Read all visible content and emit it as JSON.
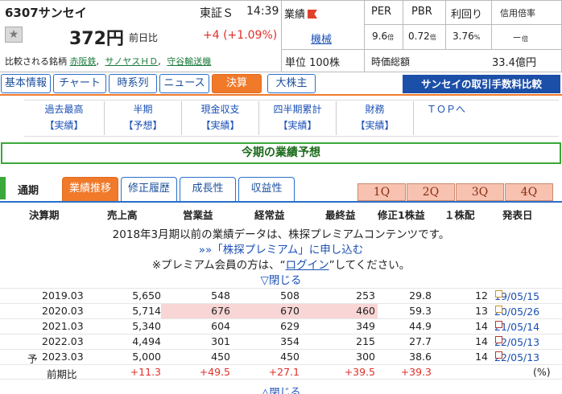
{
  "header": {
    "code_name": "6307サンセイ",
    "market": "東証Ｓ",
    "time": "14:39",
    "gyoseki_label": "業績",
    "price": "372円",
    "prev_label": "前日比",
    "change": "+4",
    "change_pct": "(+1.09%)",
    "sector": "機械",
    "compare_label": "比較される銘柄",
    "peers": [
      "赤阪鉄",
      "サノヤスＨＤ",
      "守谷輸送機"
    ],
    "unit": "単位 100株",
    "per_label": "PER",
    "pbr_label": "PBR",
    "yield_label": "利回り",
    "margin_label": "信用倍率",
    "per": "9.6",
    "per_unit": "倍",
    "pbr": "0.72",
    "pbr_unit": "倍",
    "yield": "3.76",
    "yield_unit": "%",
    "margin": "－",
    "margin_unit": "倍",
    "mcap_label": "時価総額",
    "mcap": "33.4億円"
  },
  "tabs": [
    "基本情報",
    "チャート",
    "時系列",
    "ニュース",
    "決算",
    "大株主"
  ],
  "fee_button": "サンセイの取引手数料比較",
  "subnav": [
    {
      "l1": "過去最高",
      "l2": "【実績】"
    },
    {
      "l1": "半期",
      "l2": "【予想】"
    },
    {
      "l1": "現金収支",
      "l2": "【実績】"
    },
    {
      "l1": "四半期累計",
      "l2": "【実績】"
    },
    {
      "l1": "財務",
      "l2": "【実績】"
    },
    {
      "l1": "ＴＯＰへ",
      "l2": ""
    }
  ],
  "forecast_title": "今期の業績予想",
  "section": {
    "label": "通期",
    "tabs": [
      "業績推移",
      "修正履歴",
      "成長性",
      "収益性"
    ],
    "quarters": [
      "1Q",
      "2Q",
      "3Q",
      "4Q"
    ]
  },
  "table": {
    "headers": [
      "決算期",
      "売上高",
      "営業益",
      "経常益",
      "最終益",
      "修正1株益",
      "１株配",
      "発表日"
    ],
    "premium_note1": "2018年3月期以前の業績データは、株探プレミアムコンテンツです。",
    "premium_link": "»»「株探プレミアム」に申し込む",
    "premium_note2a": "※プレミアム会員の方は、“",
    "premium_login": "ログイン",
    "premium_note2b": "”してください。",
    "close_label": "▽閉じる",
    "rows": [
      {
        "pre": "",
        "period": "2019.03",
        "sales": "5,650",
        "op": "548",
        "ord": "508",
        "net": "253",
        "eps": "29.8",
        "div": "12",
        "date": "19/05/15"
      },
      {
        "pre": "",
        "period": "2020.03",
        "sales": "5,714",
        "op": "676",
        "ord": "670",
        "net": "460",
        "eps": "59.3",
        "div": "13",
        "date": "20/05/26"
      },
      {
        "pre": "",
        "period": "2021.03",
        "sales": "5,340",
        "op": "604",
        "ord": "629",
        "net": "349",
        "eps": "44.9",
        "div": "14",
        "date": "21/05/14"
      },
      {
        "pre": "",
        "period": "2022.03",
        "sales": "4,494",
        "op": "301",
        "ord": "354",
        "net": "215",
        "eps": "27.7",
        "div": "14",
        "date": "22/05/13"
      },
      {
        "pre": "予",
        "period": "2023.03",
        "sales": "5,000",
        "op": "450",
        "ord": "450",
        "net": "300",
        "eps": "38.6",
        "div": "14",
        "date": "22/05/13"
      }
    ],
    "yoy": {
      "label": "前期比",
      "sales": "+11.3",
      "op": "+49.5",
      "ord": "+27.1",
      "net": "+39.5",
      "eps": "+39.3",
      "unit": "(%)"
    }
  },
  "bottom_partial": "△閉じる"
}
